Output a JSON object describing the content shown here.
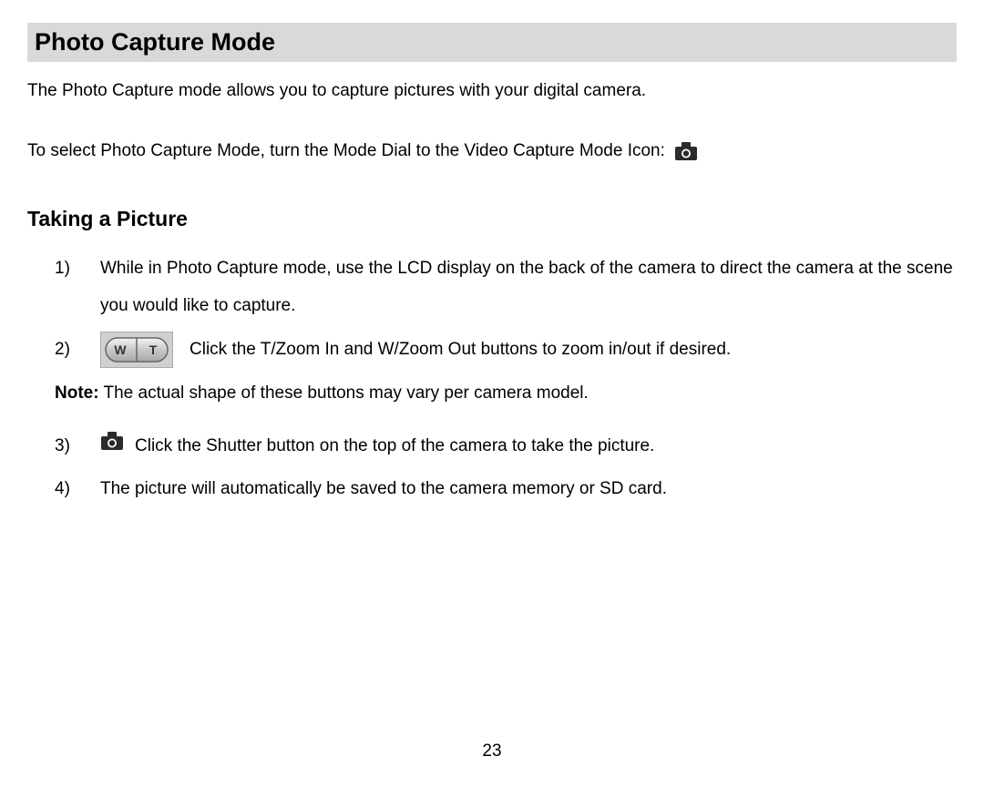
{
  "heading": "Photo Capture Mode",
  "intro_para": "The Photo Capture mode allows you to capture pictures with your digital camera.",
  "select_para": "To select Photo Capture Mode, turn the Mode Dial to the Video Capture Mode Icon:",
  "sub_heading": "Taking a Picture",
  "steps": {
    "s1_num": "1)",
    "s1_text": "While in Photo Capture mode, use the LCD display on the back of the camera to direct the camera at the scene you would like to capture.",
    "s2_num": "2)",
    "s2_text": "Click the T/Zoom In and W/Zoom Out buttons to zoom in/out if desired.",
    "note_label": "Note:",
    "note_text": " The actual shape of these buttons may vary per camera model.",
    "s3_num": "3)",
    "s3_text": "Click the Shutter button on the top of the camera to take the picture.",
    "s4_num": "4)",
    "s4_text": "The picture will automatically be saved to the camera memory or SD card."
  },
  "page_number": "23",
  "icons": {
    "camera": "camera-icon",
    "zoom_wt": "zoom-wt-button"
  }
}
